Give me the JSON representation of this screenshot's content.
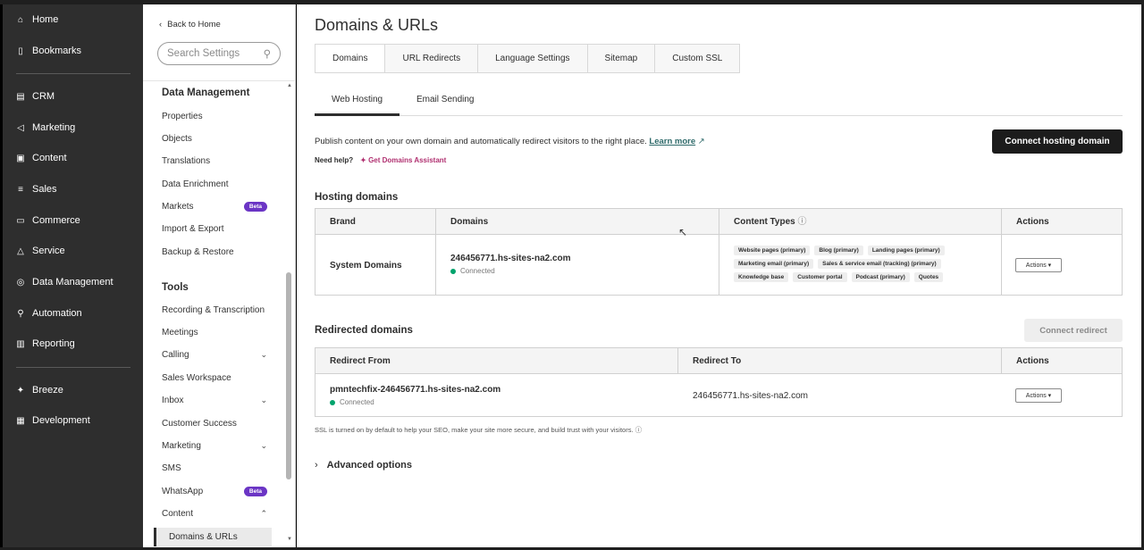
{
  "nav": {
    "items": [
      {
        "label": "Home",
        "icon": "home-icon"
      },
      {
        "label": "Bookmarks",
        "icon": "bookmark-icon"
      },
      {
        "label": "CRM",
        "icon": "crm-icon"
      },
      {
        "label": "Marketing",
        "icon": "megaphone-icon"
      },
      {
        "label": "Content",
        "icon": "content-icon"
      },
      {
        "label": "Sales",
        "icon": "sales-icon"
      },
      {
        "label": "Commerce",
        "icon": "commerce-icon"
      },
      {
        "label": "Service",
        "icon": "service-icon"
      },
      {
        "label": "Data Management",
        "icon": "database-icon"
      },
      {
        "label": "Automation",
        "icon": "automation-icon"
      },
      {
        "label": "Reporting",
        "icon": "chart-icon"
      },
      {
        "label": "Breeze",
        "icon": "sparkle-icon"
      },
      {
        "label": "Development",
        "icon": "code-icon"
      }
    ]
  },
  "settings": {
    "back_label": "Back to Home",
    "search_placeholder": "Search Settings",
    "data_management_title": "Data Management",
    "data_management_items": [
      "Properties",
      "Objects",
      "Translations",
      "Data Enrichment",
      "Markets",
      "Import & Export",
      "Backup & Restore"
    ],
    "beta_label": "Beta",
    "tools_title": "Tools",
    "tools_items": [
      "Recording & Transcription",
      "Meetings",
      "Calling",
      "Sales Workspace",
      "Inbox",
      "Customer Success",
      "Marketing",
      "SMS",
      "WhatsApp",
      "Content"
    ],
    "active_item": "Domains & URLs"
  },
  "main": {
    "title": "Domains & URLs",
    "tabs": [
      "Domains",
      "URL Redirects",
      "Language Settings",
      "Sitemap",
      "Custom SSL"
    ],
    "subtabs": [
      "Web Hosting",
      "Email Sending"
    ],
    "description": "Publish content on your own domain and automatically redirect visitors to the right place.",
    "learn_more": "Learn more",
    "need_help": "Need help?",
    "assistant": "Get Domains Assistant",
    "connect_hosting": "Connect hosting domain",
    "hosting_title": "Hosting domains",
    "hosting_headers": [
      "Brand",
      "Domains",
      "Content Types",
      "Actions"
    ],
    "hosting_row": {
      "brand": "System Domains",
      "domain": "246456771.hs-sites-na2.com",
      "status": "Connected",
      "content_types": [
        "Website pages (primary)",
        "Blog (primary)",
        "Landing pages (primary)",
        "Marketing email (primary)",
        "Sales & service email (tracking) (primary)",
        "Knowledge base",
        "Customer portal",
        "Podcast (primary)",
        "Quotes"
      ],
      "actions": "Actions ▾"
    },
    "redirect_title": "Redirected domains",
    "connect_redirect": "Connect redirect",
    "redirect_headers": [
      "Redirect From",
      "Redirect To",
      "Actions"
    ],
    "redirect_row": {
      "from": "pmntechfix-246456771.hs-sites-na2.com",
      "status": "Connected",
      "to": "246456771.hs-sites-na2.com",
      "actions": "Actions ▾"
    },
    "ssl_note": "SSL is turned on by default to help your SEO, make your site more secure, and build trust with your visitors.",
    "advanced": "Advanced options"
  }
}
